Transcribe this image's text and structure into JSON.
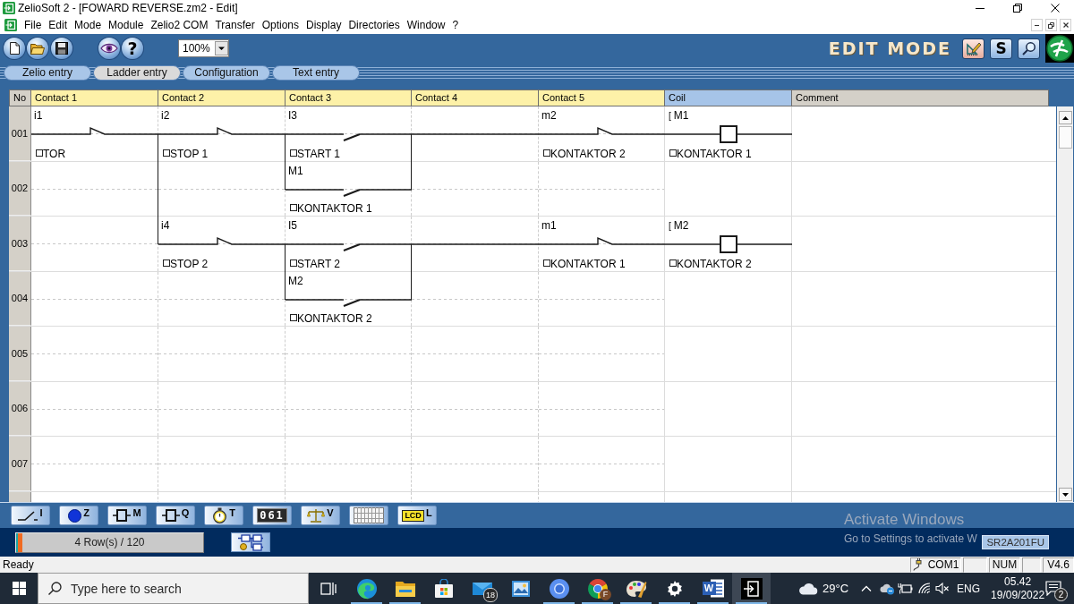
{
  "window": {
    "title": "ZelioSoft 2 - [FOWARD REVERSE.zm2 - Edit]"
  },
  "menu": [
    "File",
    "Edit",
    "Mode",
    "Module",
    "Zelio2 COM",
    "Transfer",
    "Options",
    "Display",
    "Directories",
    "Window",
    "?"
  ],
  "toolbar": {
    "buttons": [
      {
        "kind": "new"
      },
      {
        "kind": "open"
      },
      {
        "kind": "save"
      },
      {
        "kind": "view"
      },
      {
        "kind": "help",
        "glyph": "?"
      }
    ],
    "zoom": "100%",
    "mode": "EDIT MODE",
    "mode_buttons": [
      {
        "kind": "edit"
      },
      {
        "kind": "simulate",
        "glyph": "S"
      },
      {
        "kind": "monitor"
      }
    ]
  },
  "tabs": [
    {
      "label": "Zelio entry",
      "selected": false
    },
    {
      "label": "Ladder entry",
      "selected": true
    },
    {
      "label": "Configuration",
      "selected": false
    },
    {
      "label": "Text entry",
      "selected": false
    }
  ],
  "ladder": {
    "columns": [
      {
        "label": "No",
        "kind": "number"
      },
      {
        "label": "Contact 1",
        "kind": "contact"
      },
      {
        "label": "Contact 2",
        "kind": "contact"
      },
      {
        "label": "Contact 3",
        "kind": "contact"
      },
      {
        "label": "Contact 4",
        "kind": "contact"
      },
      {
        "label": "Contact 5",
        "kind": "contact"
      },
      {
        "label": "Coil",
        "kind": "coil"
      },
      {
        "label": "Comment",
        "kind": "comment"
      }
    ],
    "rows": [
      {
        "number": "001",
        "cells": [
          {
            "kind": "nc_contact",
            "address": "i1",
            "label": "TOR",
            "link_down": false
          },
          {
            "kind": "nc_contact",
            "address": "i2",
            "label": "STOP 1",
            "link_down": true
          },
          {
            "kind": "no_contact",
            "address": "I3",
            "label": "START 1",
            "link_down": true
          },
          {
            "kind": "wire",
            "link_down": true
          },
          {
            "kind": "nc_contact",
            "address": "m2",
            "label": "KONTAKTOR 2",
            "link_down": false
          },
          {
            "kind": "coil",
            "marker": "[",
            "address": "M1",
            "label": "KONTAKTOR 1",
            "link_down": false
          }
        ]
      },
      {
        "number": "002",
        "cells": [
          {
            "kind": "none",
            "link_down": false
          },
          {
            "kind": "none",
            "link_down": true
          },
          {
            "kind": "no_contact",
            "address": "M1",
            "label": "KONTAKTOR 1",
            "link_down": false
          },
          {
            "kind": "none",
            "link_down": false
          },
          {
            "kind": "none",
            "link_down": false
          },
          {
            "kind": "none",
            "link_down": false
          }
        ]
      },
      {
        "number": "003",
        "cells": [
          {
            "kind": "none",
            "link_down": false
          },
          {
            "kind": "nc_contact",
            "address": "i4",
            "label": "STOP 2",
            "link_down": false
          },
          {
            "kind": "no_contact",
            "address": "I5",
            "label": "START 2",
            "link_down": true
          },
          {
            "kind": "wire",
            "link_down": true
          },
          {
            "kind": "nc_contact",
            "address": "m1",
            "label": "KONTAKTOR 1",
            "link_down": false
          },
          {
            "kind": "coil",
            "marker": "[",
            "address": "M2",
            "label": "KONTAKTOR 2",
            "link_down": false
          }
        ]
      },
      {
        "number": "004",
        "cells": [
          {
            "kind": "none",
            "link_down": false
          },
          {
            "kind": "none",
            "link_down": false
          },
          {
            "kind": "no_contact",
            "address": "M2",
            "label": "KONTAKTOR 2",
            "link_down": false
          },
          {
            "kind": "none",
            "link_down": false
          },
          {
            "kind": "none",
            "link_down": false
          },
          {
            "kind": "none",
            "link_down": false
          }
        ]
      },
      {
        "number": "005"
      },
      {
        "number": "006"
      },
      {
        "number": "007"
      }
    ]
  },
  "palette": [
    {
      "kind": "contact",
      "letter": "I"
    },
    {
      "kind": "key",
      "letter": "Z"
    },
    {
      "kind": "relay",
      "letter": "M"
    },
    {
      "kind": "output",
      "letter": "Q"
    },
    {
      "kind": "timer",
      "letter": "T"
    },
    {
      "kind": "counter",
      "face": "061"
    },
    {
      "kind": "analog",
      "letter": "V"
    },
    {
      "kind": "text"
    },
    {
      "kind": "lcd",
      "face": "LCD",
      "letter": "L"
    }
  ],
  "info_bar": {
    "progress": {
      "text": "4 Row(s) / 120",
      "level": 0.033
    },
    "module": "SR2A201FU"
  },
  "activation": {
    "title": "Activate Windows",
    "text": "Go to Settings to activate W"
  },
  "status_bar": {
    "message": "Ready",
    "panels": [
      {
        "kind": "port",
        "text": "COM1"
      },
      {
        "kind": "blank"
      },
      {
        "kind": "plain",
        "text": "NUM"
      },
      {
        "kind": "blank"
      },
      {
        "kind": "plain",
        "text": "V4.6"
      }
    ]
  },
  "taskbar": {
    "search": {
      "placeholder": "Type here to search"
    },
    "apps": [
      {
        "kind": "task_view",
        "running": false,
        "active": false
      },
      {
        "kind": "browser",
        "running": true,
        "active": false
      },
      {
        "kind": "folder",
        "running": true,
        "active": false
      },
      {
        "kind": "store",
        "running": false,
        "active": false
      },
      {
        "kind": "mail",
        "badge": "18",
        "running": false,
        "active": false
      },
      {
        "kind": "photos",
        "running": false,
        "active": false
      },
      {
        "kind": "chromium",
        "running": true,
        "active": false
      },
      {
        "kind": "chrome",
        "badge": "F",
        "running": true,
        "active": false
      },
      {
        "kind": "paint",
        "running": true,
        "active": false
      },
      {
        "kind": "settings",
        "running": true,
        "active": false
      },
      {
        "kind": "word",
        "glyph": "W",
        "running": true,
        "active": false
      },
      {
        "kind": "zelio",
        "running": true,
        "active": true
      }
    ],
    "tray": {
      "temperature": "29°C",
      "language": "ENG",
      "time": "05.42",
      "date": "19/09/2022",
      "notifications": "2"
    }
  }
}
